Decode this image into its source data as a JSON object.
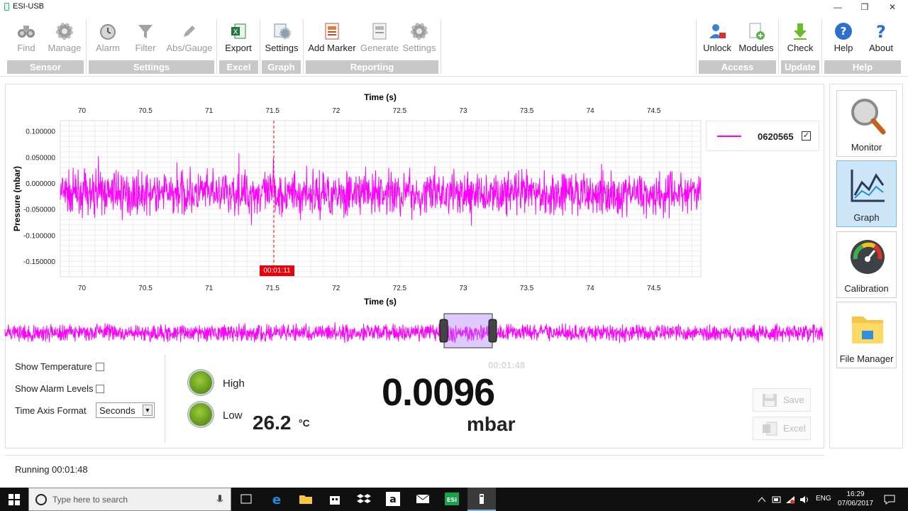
{
  "window": {
    "title": "ESI-USB"
  },
  "ribbon": {
    "tools": [
      {
        "id": "find",
        "label": "Find"
      },
      {
        "id": "manage",
        "label": "Manage"
      },
      {
        "id": "alarm",
        "label": "Alarm"
      },
      {
        "id": "filter",
        "label": "Filter"
      },
      {
        "id": "absgauge",
        "label": "Abs/Gauge"
      },
      {
        "id": "export",
        "label": "Export"
      },
      {
        "id": "graph_settings",
        "label": "Settings"
      },
      {
        "id": "add_marker",
        "label": "Add Marker"
      },
      {
        "id": "generate",
        "label": "Generate"
      },
      {
        "id": "report_settings",
        "label": "Settings"
      },
      {
        "id": "unlock",
        "label": "Unlock"
      },
      {
        "id": "modules",
        "label": "Modules"
      },
      {
        "id": "check",
        "label": "Check"
      },
      {
        "id": "help",
        "label": "Help"
      },
      {
        "id": "about",
        "label": "About"
      }
    ],
    "groups": [
      "Sensor",
      "Settings",
      "Excel",
      "Graph",
      "Reporting",
      "Access",
      "Update",
      "Help"
    ]
  },
  "nav": {
    "monitor": "Monitor",
    "graph": "Graph",
    "calibration": "Calibration",
    "file_manager": "File Manager"
  },
  "chart_data": {
    "type": "line",
    "xlabel": "Time (s)",
    "ylabel": "Pressure (mbar)",
    "x_ticks": [
      "70",
      "70.5",
      "71",
      "71.5",
      "72",
      "72.5",
      "73",
      "73.5",
      "74",
      "74.5"
    ],
    "y_ticks": [
      "0.100000",
      "0.050000",
      "0.000000",
      "-0.050000",
      "-0.100000",
      "-0.150000"
    ],
    "xlim": [
      69.83,
      74.87
    ],
    "ylim": [
      -0.18,
      0.12
    ],
    "series": [
      {
        "name": "0620565",
        "color": "#ff00ff",
        "mean": -0.02,
        "amplitude": 0.06
      }
    ],
    "marker": {
      "x": 71.51,
      "label": "00:01:11"
    },
    "legend_checked": "✓",
    "grid": true
  },
  "controls": {
    "show_temperature": "Show Temperature",
    "show_alarm_levels": "Show Alarm Levels",
    "time_axis_format": "Time Axis Format",
    "time_axis_value": "Seconds",
    "arrow": "▼"
  },
  "readout": {
    "elapsed": "00:01:48",
    "high": "High",
    "low": "Low",
    "value": "0.0096",
    "unit": "mbar",
    "temperature": "26.2",
    "temp_unit": "°C"
  },
  "actions": {
    "save": "Save",
    "excel": "Excel"
  },
  "status": {
    "text": "Running 00:01:48"
  },
  "taskbar": {
    "search_placeholder": "Type here to search",
    "lang": "ENG",
    "time": "16:29",
    "date": "07/06/2017"
  }
}
